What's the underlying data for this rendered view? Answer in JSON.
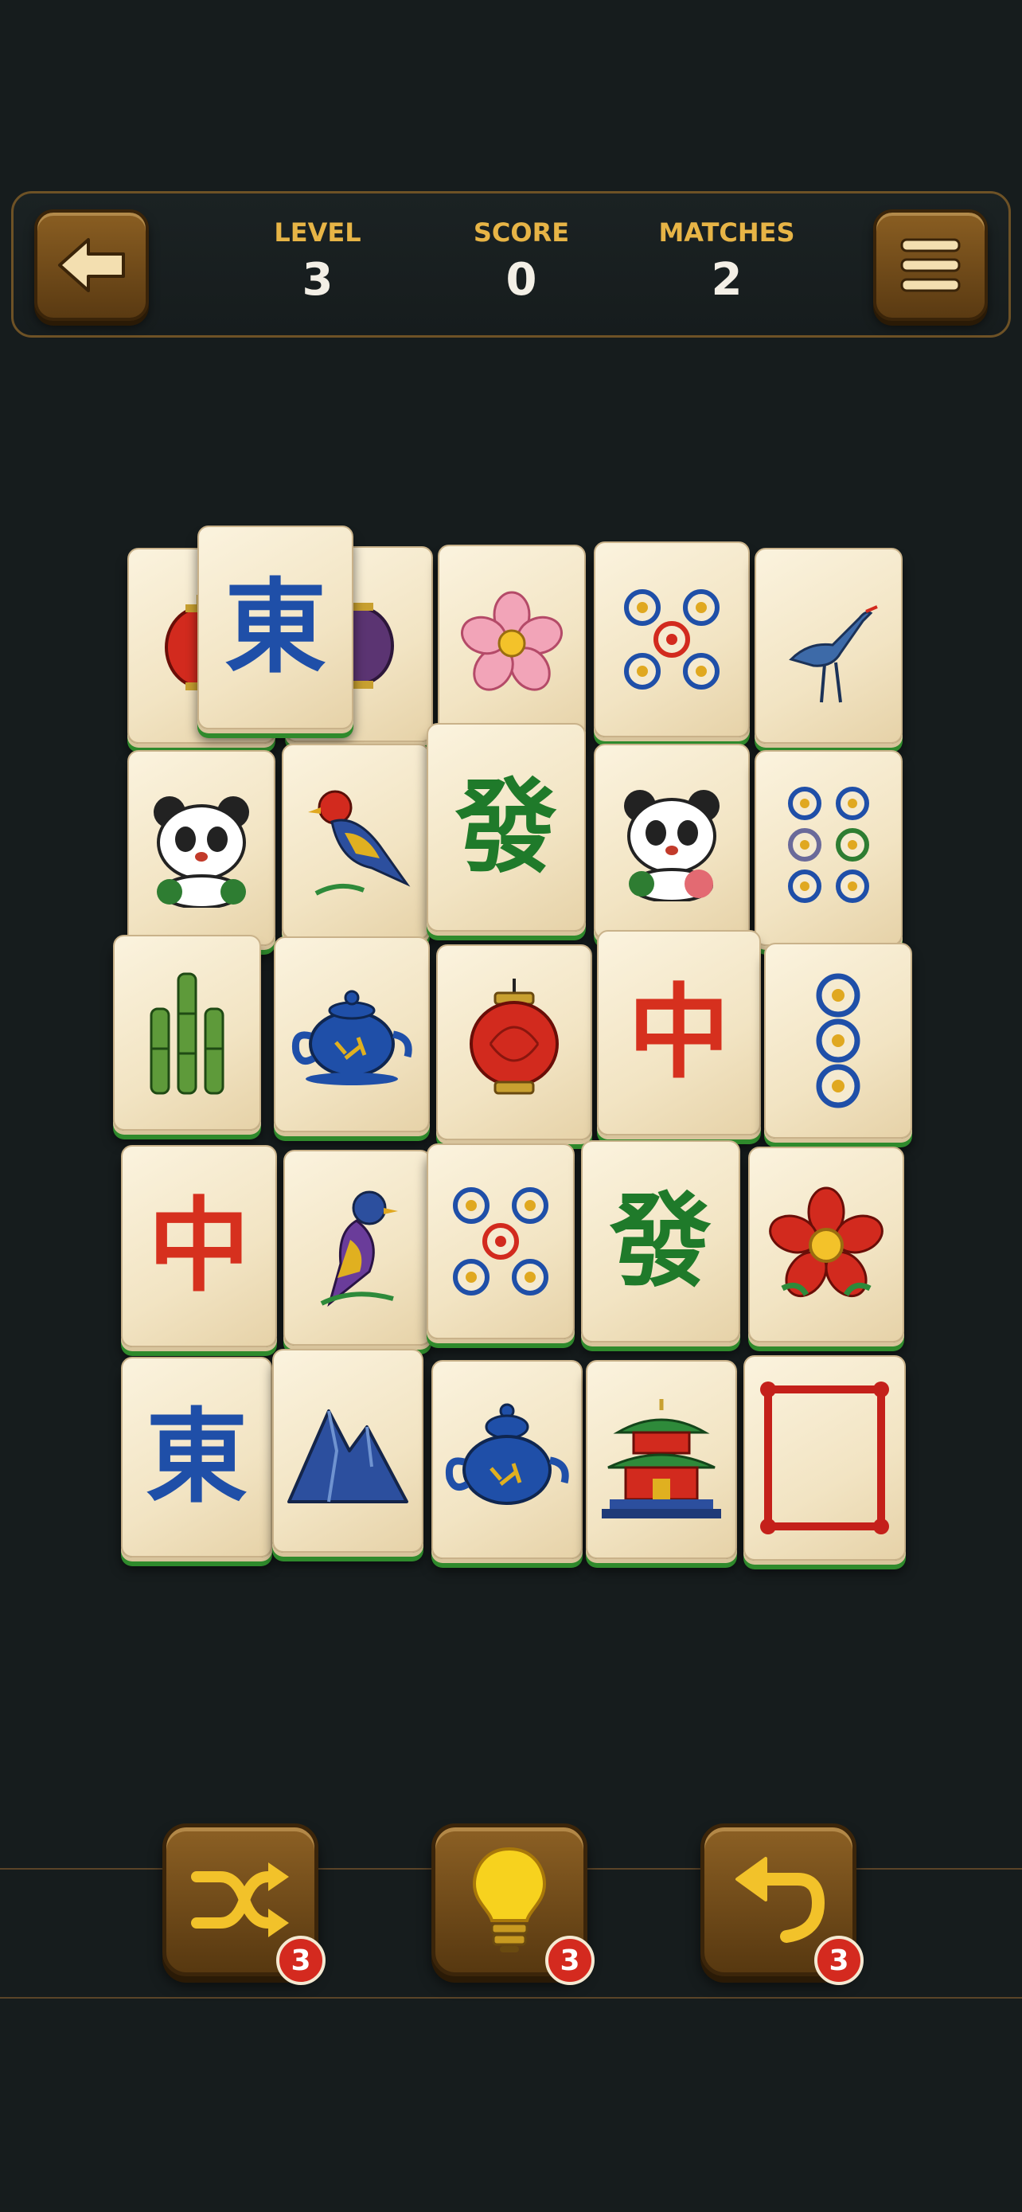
{
  "hud": {
    "level_label": "LEVEL",
    "level_value": "3",
    "score_label": "SCORE",
    "score_value": "0",
    "matches_label": "MATCHES",
    "matches_value": "2",
    "back_icon": "arrow-left-icon",
    "menu_icon": "hamburger-menu-icon"
  },
  "tiles": {
    "east_1": "東",
    "east_2": "東",
    "green_dragon_1": "發",
    "green_dragon_2": "發",
    "red_dragon_1": "中",
    "red_dragon_2": "中"
  },
  "tools": {
    "shuffle": {
      "icon": "shuffle-icon",
      "count": "3"
    },
    "hint": {
      "icon": "lightbulb-icon",
      "count": "3"
    },
    "undo": {
      "icon": "undo-icon",
      "count": "3"
    }
  },
  "colors": {
    "background": "#161c1d",
    "accent_gold": "#e7b446",
    "button_brown": "#7a5220",
    "tile_face": "#f5ead0",
    "tile_base_green": "#2f8a2c",
    "badge_red": "#d42a1f",
    "east_blue": "#1f4fa8",
    "dragon_green": "#1f7a2a",
    "dragon_red": "#d6301e"
  }
}
